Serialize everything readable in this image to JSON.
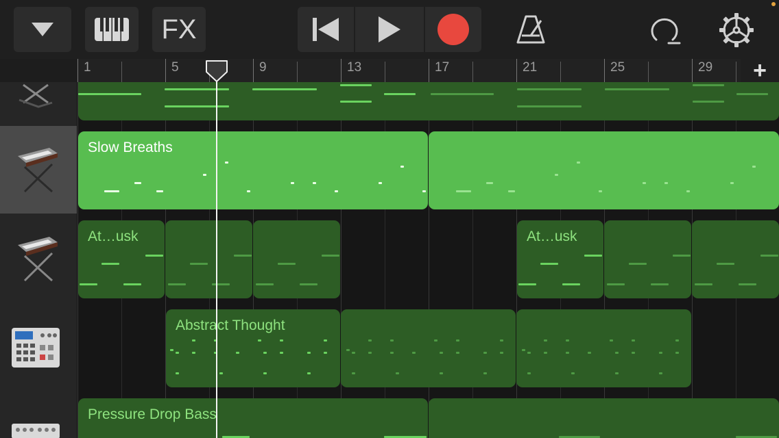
{
  "toolbar": {
    "buttons": [
      "tracks-dropdown",
      "piano-keyboard",
      "fx",
      "go-to-start",
      "play",
      "record",
      "metronome",
      "loop-browser",
      "settings"
    ],
    "fx_label": "FX"
  },
  "ruler": {
    "bar_labels": [
      "1",
      "5",
      "9",
      "13",
      "17",
      "21",
      "25",
      "29"
    ],
    "add_label": "+"
  },
  "playhead": {
    "bar_position": 7.3
  },
  "tracks": [
    {
      "instrument": "keyboard-stand-icon",
      "selected": false
    },
    {
      "instrument": "keyboard-stand-icon",
      "selected": true
    },
    {
      "instrument": "keyboard-stand-icon",
      "selected": false
    },
    {
      "instrument": "drum-machine-icon",
      "selected": false
    },
    {
      "instrument": "synth-module-icon",
      "selected": false
    }
  ],
  "regions": {
    "slow_breaths": "Slow Breaths",
    "at_dusk_1": "At…usk",
    "at_dusk_2": "At…usk",
    "abstract_thought": "Abstract Thought",
    "pressure_drop_bass": "Pressure Drop Bass"
  },
  "colors": {
    "record": "#e8483e",
    "region_dark": "#2d5d25",
    "region_bright": "#58bd50",
    "accent_dot": "#e3a23e"
  }
}
